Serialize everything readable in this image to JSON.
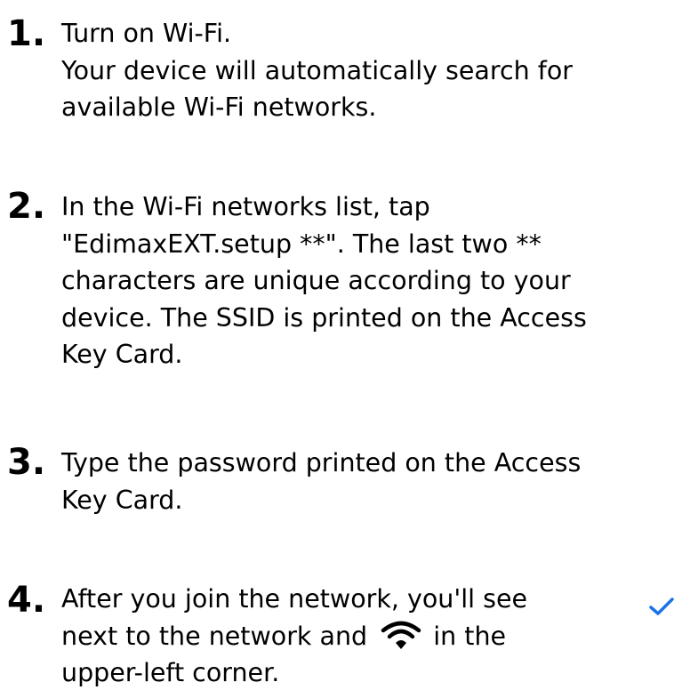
{
  "steps": [
    {
      "number": "1.",
      "lines": [
        "Turn on Wi-Fi.",
        "Your device will automatically search for",
        "available Wi-Fi networks."
      ]
    },
    {
      "number": "2.",
      "lines": [
        "In the Wi-Fi networks list, tap",
        "\"EdimaxEXT.setup **\". The last two **",
        "characters are unique according to your",
        "device. The SSID is printed on the Access",
        "Key Card."
      ]
    },
    {
      "number": "3.",
      "lines": [
        "Type the password printed on the Access",
        "Key Card."
      ]
    },
    {
      "number": "4.",
      "line1": "After you join the network, you'll see",
      "line2_before": "next to the network and",
      "line2_after": "in the",
      "line3": "upper-left corner."
    }
  ],
  "icons": {
    "check": "checkmark-icon",
    "wifi": "wifi-icon",
    "check_color": "#1a73e8",
    "wifi_color": "#000000"
  }
}
